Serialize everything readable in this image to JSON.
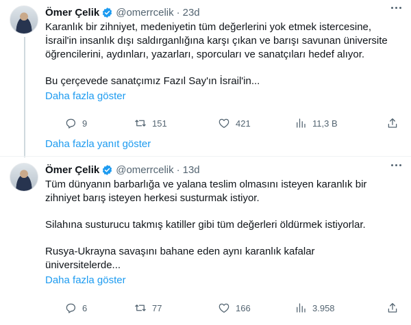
{
  "tweets": [
    {
      "author_name": "Ömer Çelik",
      "handle": "@omerrcelik",
      "separator": "·",
      "time": "23d",
      "paragraphs": [
        "Karanlık bir zihniyet, medeniyetin tüm değerlerini yok etmek istercesine,",
        "İsrail'in insanlık dışı saldırganlığına karşı çıkan ve barışı savunan üniversite",
        "öğrencilerini, aydınları, yazarları, sporcuları ve sanatçıları hedef alıyor.",
        "",
        "Bu çerçevede sanatçımız Fazıl Say'ın İsrail'in..."
      ],
      "show_more_label": "Daha fazla göster",
      "replies": "9",
      "retweets": "151",
      "likes": "421",
      "views": "11,3 B"
    },
    {
      "author_name": "Ömer Çelik",
      "handle": "@omerrcelik",
      "separator": "·",
      "time": "13d",
      "paragraphs": [
        "Tüm dünyanın barbarlığa ve yalana teslim olmasını isteyen karanlık bir",
        "zihniyet barış isteyen herkesi susturmak istiyor.",
        "",
        "Silahına susturucu takmış katiller gibi tüm değerleri öldürmek istiyorlar.",
        "",
        "Rusya-Ukrayna savaşını bahane eden aynı karanlık kafalar",
        "üniversitelerde..."
      ],
      "show_more_label": "Daha fazla göster",
      "replies": "6",
      "retweets": "77",
      "likes": "166",
      "views": "3.958"
    }
  ],
  "thread": {
    "show_replies_label": "Daha fazla yanıt göster"
  },
  "colors": {
    "accent": "#1d9bf0",
    "text": "#0f1419",
    "muted": "#536471",
    "verified_badge": "#1d9bf0"
  },
  "icons": {
    "verified": "verified-badge-icon",
    "reply": "reply-icon",
    "retweet": "retweet-icon",
    "like": "heart-icon",
    "views": "views-chart-icon",
    "share": "share-icon",
    "more": "more-icon"
  }
}
